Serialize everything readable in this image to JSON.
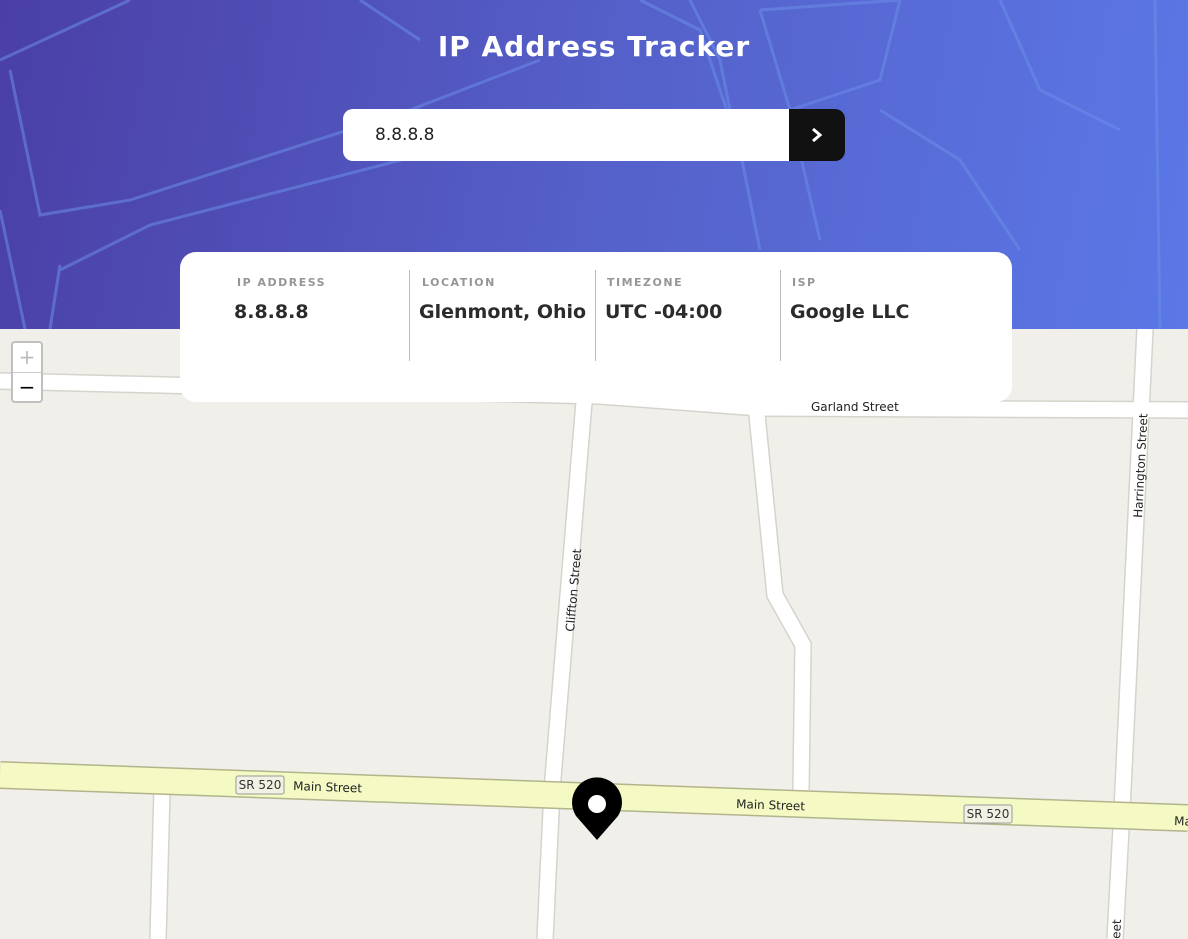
{
  "header": {
    "title": "IP Address Tracker"
  },
  "search": {
    "value": "8.8.8.8",
    "submit_icon": "chevron-right-icon"
  },
  "info": {
    "ip_label": "IP ADDRESS",
    "ip_value": "8.8.8.8",
    "location_label": "LOCATION",
    "location_value": "Glenmont, Ohio",
    "timezone_label": "TIMEZONE",
    "timezone_value": "UTC -04:00",
    "isp_label": "ISP",
    "isp_value": "Google LLC"
  },
  "map": {
    "zoom_in": "+",
    "zoom_out": "−",
    "streets": {
      "garland": "Garland Street",
      "clifton": "Cliffton Street",
      "harrington": "Harrington Street",
      "main_1": "Main Street",
      "main_2": "Main Street",
      "main_3": "Ma",
      "harrington_bottom": "eet"
    },
    "route_shields": [
      "SR 520",
      "SR 520"
    ],
    "marker_icon": "location-pin-icon"
  },
  "colors": {
    "hero_start": "#4a3fa6",
    "hero_end": "#5b78e6",
    "primary_road": "#f5f9c4",
    "land": "#f1efe9",
    "button": "#111111"
  }
}
